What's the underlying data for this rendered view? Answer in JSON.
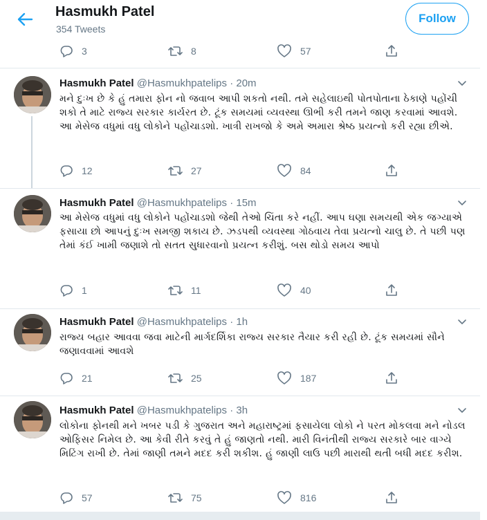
{
  "header": {
    "name": "Hasmukh Patel",
    "tweet_count": "354 Tweets",
    "follow_label": "Follow"
  },
  "top_actions": {
    "replies": "3",
    "retweets": "8",
    "likes": "57"
  },
  "tweets": [
    {
      "name": "Hasmukh Patel",
      "handle": "@Hasmukhpatelips",
      "time": "· 20m",
      "text": "મને દુઃખ છે કે હું તમારા ફોન નો જવાબ આપી શકતો નથી. તમે સહેલાઇથી પોતપોતાના ઠેકાણે પહોંચી શકો તે માટે રાજ્ય સરકાર કાર્યરત છે. ટૂંક સમયમાં વ્યવસ્થા ઊભી કરી તમને જાણ કરવામાં આવશે. આ મેસેજ વધુમાં વધુ લોકોને પહોંચાડશો. ખાત્રી રાખજો કે અમે અમારા શ્રેષ્ઠ પ્રયત્નો કરી રહ્યા છીએ.",
      "replies": "12",
      "retweets": "27",
      "likes": "84"
    },
    {
      "name": "Hasmukh Patel",
      "handle": "@Hasmukhpatelips",
      "time": "· 15m",
      "text": "આ મેસેજ વધુમાં વધુ લોકોને પહોંચાડશો જેથી તેઓ ચિંતા કરે નહીં. આપ ઘણા સમયથી એક જગ્યાએ ફસાયા છો આપનું દુઃખ સમજી શકાય છે. ઝડપથી વ્યવસ્થા ગોઠવાય તેવા પ્રયત્નો ચાલુ છે. તે પછી પણ તેમાં કંઈ ખામી જણાશે તો સતત સુધારવાનો પ્રયત્ન કરીશું. બસ થોડો સમય આપો",
      "replies": "1",
      "retweets": "11",
      "likes": "40"
    },
    {
      "name": "Hasmukh Patel",
      "handle": "@Hasmukhpatelips",
      "time": "· 1h",
      "text": "રાજ્ય બહાર આવવા જવા માટેની માર્ગદર્શિકા રાજ્ય સરકાર તૈયાર કરી રહી છે. ટૂંક સમયમાં સૌને જણાવવામાં આવશે",
      "replies": "21",
      "retweets": "25",
      "likes": "187"
    },
    {
      "name": "Hasmukh Patel",
      "handle": "@Hasmukhpatelips",
      "time": "· 3h",
      "text": "લોકોના ફોનથી મને ખબર પડી કે ગુજરાત અને મહારાષ્ટ્રમાં ફસાયેલા લોકો ને પરત મોકલવા મને નોડલ ઓફિસર નિમેલ છે. આ કેવી રીતે કરવું તે હું જાણતો નથી. મારી વિનંતીથી રાજ્ય સરકારે બાર વાગ્યે મિટિંગ રાખી છે. તેમાં જાણી તમને મદદ કરી શકીશ. હું જાણી લાઉ પછી મારાથી થતી બધી મદદ કરીશ.",
      "replies": "57",
      "retweets": "75",
      "likes": "816"
    }
  ],
  "icons": {
    "back": "arrow-left-icon",
    "reply": "reply-icon",
    "retweet": "retweet-icon",
    "like": "heart-icon",
    "share": "share-icon",
    "caret": "chevron-down-icon"
  },
  "colors": {
    "accent": "#1da1f2",
    "muted": "#657786",
    "divider": "#e1e8ed"
  }
}
